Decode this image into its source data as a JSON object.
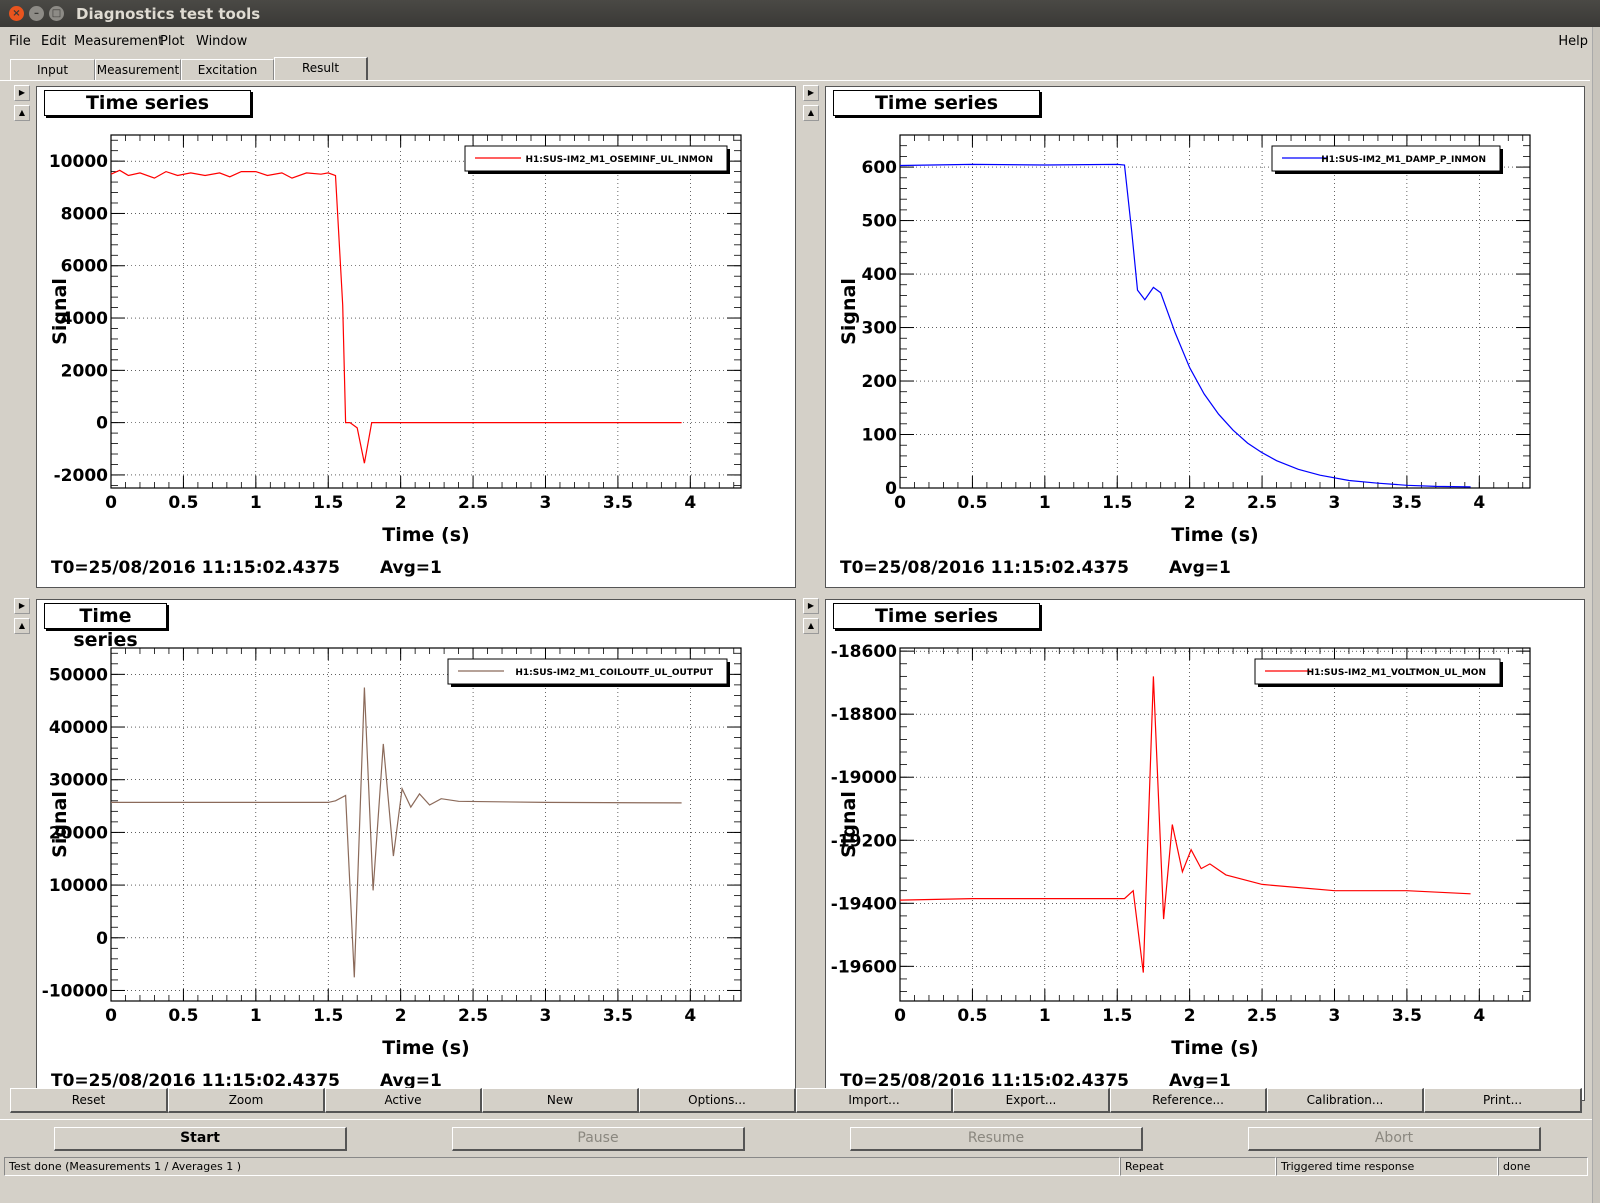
{
  "window": {
    "title": "Diagnostics test tools"
  },
  "menu": {
    "file": "File",
    "edit": "Edit",
    "measurement": "Measurement",
    "plot": "Plot",
    "window": "Window",
    "help": "Help"
  },
  "tabs": {
    "input": "Input",
    "measurement": "Measurement",
    "excitation": "Excitation",
    "result": "Result"
  },
  "colors": {
    "red": "#ff0000",
    "blue": "#0000ff",
    "brown": "#8b6a5a"
  },
  "panels": [
    {
      "title": "Time series",
      "legend": "H1:SUS-IM2_M1_OSEMINF_UL_INMON",
      "t0": "T0=25/08/2016 11:15:02.4375",
      "avg": "Avg=1",
      "xlabel": "Time (s)",
      "ylabel": "Signal"
    },
    {
      "title": "Time series",
      "legend": "H1:SUS-IM2_M1_DAMP_P_INMON",
      "t0": "T0=25/08/2016 11:15:02.4375",
      "avg": "Avg=1",
      "xlabel": "Time (s)",
      "ylabel": "Signal"
    },
    {
      "title": "Time series",
      "legend": "H1:SUS-IM2_M1_COILOUTF_UL_OUTPUT",
      "t0": "T0=25/08/2016 11:15:02.4375",
      "avg": "Avg=1",
      "xlabel": "Time (s)",
      "ylabel": "Signal"
    },
    {
      "title": "Time series",
      "legend": "H1:SUS-IM2_M1_VOLTMON_UL_MON",
      "t0": "T0=25/08/2016 11:15:02.4375",
      "avg": "Avg=1",
      "xlabel": "Time (s)",
      "ylabel": "Signal"
    }
  ],
  "chart_data": [
    {
      "type": "line",
      "title": "Time series",
      "xlabel": "Time (s)",
      "ylabel": "Signal",
      "xlim": [
        0,
        4.35
      ],
      "ylim": [
        -2500,
        11000
      ],
      "xticks": [
        "0",
        "0.5",
        "1",
        "1.5",
        "2",
        "2.5",
        "3",
        "3.5",
        "4"
      ],
      "yticks": [
        "-2000",
        "0",
        "2000",
        "4000",
        "6000",
        "8000",
        "10000"
      ],
      "grid": true,
      "legend_position": "top-right",
      "series": [
        {
          "name": "H1:SUS-IM2_M1_OSEMINF_UL_INMON",
          "color": "#ff0000",
          "x": [
            0,
            0.06,
            0.12,
            0.2,
            0.3,
            0.38,
            0.46,
            0.55,
            0.65,
            0.75,
            0.82,
            0.9,
            1.0,
            1.08,
            1.18,
            1.25,
            1.35,
            1.45,
            1.5,
            1.55,
            1.6,
            1.62,
            1.65,
            1.7,
            1.75,
            1.8,
            1.85,
            2.0,
            3.0,
            3.94
          ],
          "y": [
            9500,
            9650,
            9450,
            9550,
            9350,
            9600,
            9450,
            9550,
            9450,
            9550,
            9400,
            9600,
            9600,
            9450,
            9550,
            9350,
            9550,
            9500,
            9550,
            9450,
            4500,
            0,
            0,
            -200,
            -1550,
            0,
            0,
            0,
            0,
            0
          ]
        }
      ]
    },
    {
      "type": "line",
      "title": "Time series",
      "xlabel": "Time (s)",
      "ylabel": "Signal",
      "xlim": [
        0,
        4.35
      ],
      "ylim": [
        0,
        660
      ],
      "xticks": [
        "0",
        "0.5",
        "1",
        "1.5",
        "2",
        "2.5",
        "3",
        "3.5",
        "4"
      ],
      "yticks": [
        "0",
        "100",
        "200",
        "300",
        "400",
        "500",
        "600"
      ],
      "grid": true,
      "legend_position": "top-right",
      "series": [
        {
          "name": "H1:SUS-IM2_M1_DAMP_P_INMON",
          "color": "#0000ff",
          "x": [
            0,
            0.5,
            1.0,
            1.5,
            1.55,
            1.6,
            1.64,
            1.69,
            1.75,
            1.8,
            1.9,
            2.0,
            2.1,
            2.2,
            2.3,
            2.4,
            2.5,
            2.6,
            2.75,
            2.9,
            3.1,
            3.3,
            3.5,
            3.7,
            3.94
          ],
          "y": [
            603,
            605,
            604,
            605,
            604,
            480,
            370,
            352,
            375,
            365,
            290,
            225,
            176,
            138,
            108,
            84,
            66,
            51,
            35,
            24,
            14,
            9,
            5,
            3,
            2
          ]
        }
      ]
    },
    {
      "type": "line",
      "title": "Time series",
      "xlabel": "Time (s)",
      "ylabel": "Signal",
      "xlim": [
        0,
        4.35
      ],
      "ylim": [
        -12000,
        55000
      ],
      "xticks": [
        "0",
        "0.5",
        "1",
        "1.5",
        "2",
        "2.5",
        "3",
        "3.5",
        "4"
      ],
      "yticks": [
        "-10000",
        "0",
        "10000",
        "20000",
        "30000",
        "40000",
        "50000"
      ],
      "grid": true,
      "legend_position": "top-right",
      "series": [
        {
          "name": "H1:SUS-IM2_M1_COILOUTF_UL_OUTPUT",
          "color": "#8b6a5a",
          "x": [
            0,
            0.5,
            1.0,
            1.5,
            1.55,
            1.62,
            1.68,
            1.75,
            1.81,
            1.88,
            1.95,
            2.01,
            2.07,
            2.13,
            2.2,
            2.28,
            2.4,
            3.0,
            3.94
          ],
          "y": [
            25700,
            25700,
            25700,
            25700,
            26000,
            27000,
            -7500,
            47500,
            9000,
            36800,
            15500,
            28300,
            24800,
            27300,
            25200,
            26400,
            25900,
            25700,
            25600
          ]
        }
      ]
    },
    {
      "type": "line",
      "title": "Time series",
      "xlabel": "Time (s)",
      "ylabel": "Signal",
      "xlim": [
        0,
        4.35
      ],
      "ylim": [
        -19710,
        -18590
      ],
      "xticks": [
        "0",
        "0.5",
        "1",
        "1.5",
        "2",
        "2.5",
        "3",
        "3.5",
        "4"
      ],
      "yticks": [
        "-19600",
        "-19400",
        "-19200",
        "-19000",
        "-18800",
        "-18600"
      ],
      "grid": true,
      "legend_position": "top-right",
      "series": [
        {
          "name": "H1:SUS-IM2_M1_VOLTMON_UL_MON",
          "color": "#ff0000",
          "x": [
            0,
            0.5,
            1.0,
            1.5,
            1.55,
            1.61,
            1.68,
            1.75,
            1.82,
            1.88,
            1.95,
            2.01,
            2.08,
            2.14,
            2.25,
            2.5,
            3.0,
            3.5,
            3.94
          ],
          "y": [
            -19390,
            -19385,
            -19385,
            -19385,
            -19385,
            -19360,
            -19620,
            -18680,
            -19450,
            -19150,
            -19300,
            -19230,
            -19290,
            -19275,
            -19310,
            -19340,
            -19360,
            -19360,
            -19370
          ]
        }
      ]
    }
  ],
  "toolbar": {
    "reset": "Reset",
    "zoom": "Zoom",
    "active": "Active",
    "new": "New",
    "options": "Options...",
    "import": "Import...",
    "export": "Export...",
    "reference": "Reference...",
    "calibration": "Calibration...",
    "print": "Print..."
  },
  "run": {
    "start": "Start",
    "pause": "Pause",
    "resume": "Resume",
    "abort": "Abort"
  },
  "status": {
    "message": "Test done (Measurements 1 / Averages 1 )",
    "repeat": "Repeat",
    "type": "Triggered time response",
    "state": "done"
  }
}
